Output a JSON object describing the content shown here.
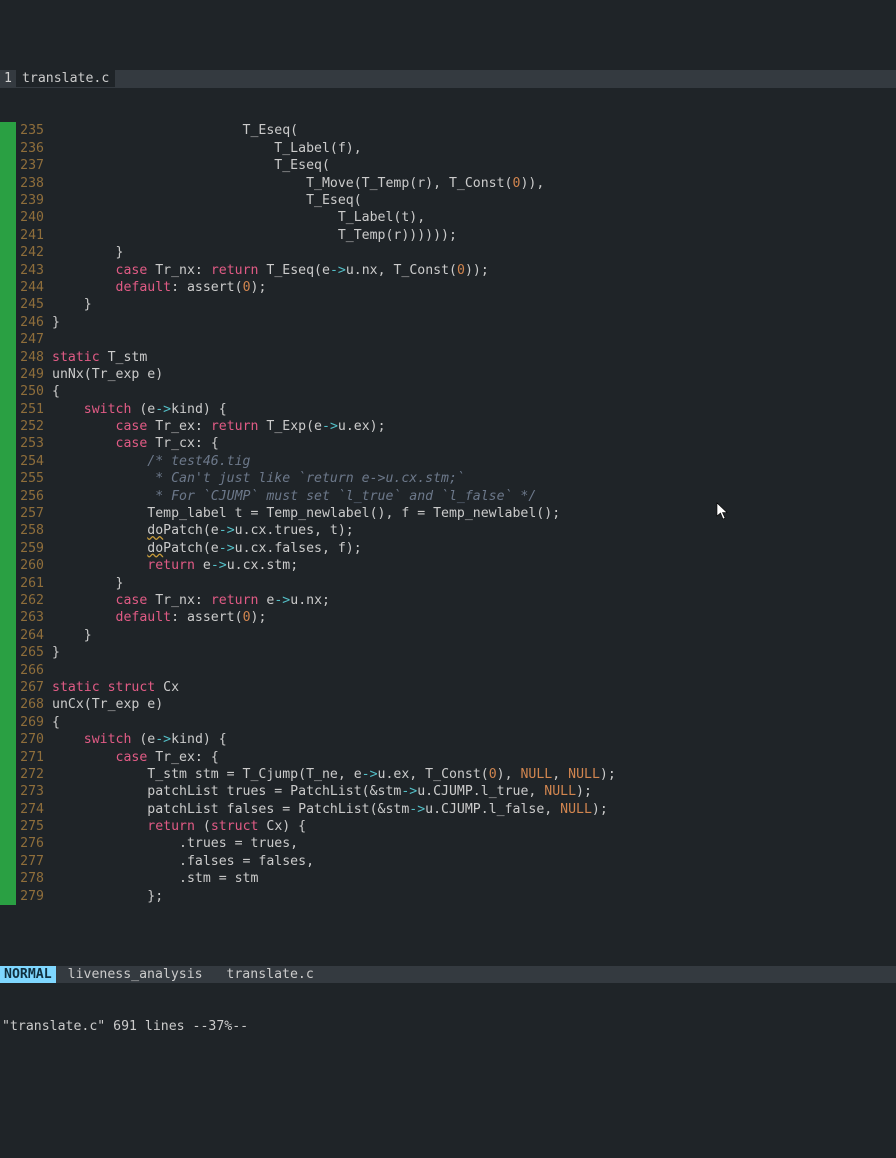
{
  "tabbar": {
    "index": "1",
    "file": "translate.c"
  },
  "statusbar": {
    "mode": "NORMAL",
    "buffers": "liveness_analysis   translate.c"
  },
  "cmdline": "\"translate.c\" 691 lines --37%--",
  "lines": [
    {
      "n": "235",
      "html": "                        T_Eseq("
    },
    {
      "n": "236",
      "html": "                            T_Label(f),"
    },
    {
      "n": "237",
      "html": "                            T_Eseq("
    },
    {
      "n": "238",
      "html": "                                T_Move(T_Temp(r), T_Const(<span class='num'>0</span>)),"
    },
    {
      "n": "239",
      "html": "                                T_Eseq("
    },
    {
      "n": "240",
      "html": "                                    T_Label(t),"
    },
    {
      "n": "241",
      "html": "                                    T_Temp(r))))));"
    },
    {
      "n": "242",
      "html": "        }"
    },
    {
      "n": "243",
      "html": "        <span class='kw'>case</span> Tr_nx: <span class='kw'>return</span> T_Eseq(e<span class='op'>-&gt;</span>u.nx, T_Const(<span class='num'>0</span>));"
    },
    {
      "n": "244",
      "html": "        <span class='kw'>default</span>: assert(<span class='num'>0</span>);"
    },
    {
      "n": "245",
      "html": "    }"
    },
    {
      "n": "246",
      "html": "}"
    },
    {
      "n": "247",
      "html": ""
    },
    {
      "n": "248",
      "html": "<span class='kw'>static</span> T_stm"
    },
    {
      "n": "249",
      "html": "unNx(Tr_exp e)"
    },
    {
      "n": "250",
      "html": "{"
    },
    {
      "n": "251",
      "html": "    <span class='kw'>switch</span> (e<span class='op'>-&gt;</span>kind) {"
    },
    {
      "n": "252",
      "html": "        <span class='kw'>case</span> Tr_ex: <span class='kw'>return</span> T_Exp(e<span class='op'>-&gt;</span>u.ex);"
    },
    {
      "n": "253",
      "html": "        <span class='kw'>case</span> Tr_cx: {"
    },
    {
      "n": "254",
      "html": "            <span class='comment'>/* test46.tig</span>"
    },
    {
      "n": "255",
      "html": "<span class='comment'>             * Can't just like `return e-&gt;u.cx.stm;`</span>"
    },
    {
      "n": "256",
      "html": "<span class='comment'>             * For `CJUMP` must set `l_true` and `l_false` */</span>"
    },
    {
      "n": "257",
      "html": "            Temp_label t = Temp_newlabel(), f = Temp_newlabel();"
    },
    {
      "n": "258",
      "html": "            <span class='underline'>do</span>Patch(e<span class='op'>-&gt;</span>u.cx.trues, t);"
    },
    {
      "n": "259",
      "html": "            <span class='underline'>do</span>Patch(e<span class='op'>-&gt;</span>u.cx.falses, f);"
    },
    {
      "n": "260",
      "html": "            <span class='kw'>return</span> e<span class='op'>-&gt;</span>u.cx.stm;"
    },
    {
      "n": "261",
      "html": "        }"
    },
    {
      "n": "262",
      "html": "        <span class='kw'>case</span> Tr_nx: <span class='kw'>return</span> e<span class='op'>-&gt;</span>u.nx;"
    },
    {
      "n": "263",
      "html": "        <span class='kw'>default</span>: assert(<span class='num'>0</span>);"
    },
    {
      "n": "264",
      "html": "    }"
    },
    {
      "n": "265",
      "html": "}"
    },
    {
      "n": "266",
      "html": ""
    },
    {
      "n": "267",
      "html": "<span class='kw'>static</span> <span class='kw'>struct</span> Cx"
    },
    {
      "n": "268",
      "html": "unCx(Tr_exp e)"
    },
    {
      "n": "269",
      "html": "{"
    },
    {
      "n": "270",
      "html": "    <span class='kw'>switch</span> (e<span class='op'>-&gt;</span>kind) {"
    },
    {
      "n": "271",
      "html": "        <span class='kw'>case</span> Tr_ex: {"
    },
    {
      "n": "272",
      "html": "            T_stm stm = T_Cjump(T_ne, e<span class='op'>-&gt;</span>u.ex, T_Const(<span class='num'>0</span>), <span class='null'>NULL</span>, <span class='null'>NULL</span>);"
    },
    {
      "n": "273",
      "html": "            patchList trues = PatchList(&amp;stm<span class='op'>-&gt;</span>u.CJUMP.l_true, <span class='null'>NULL</span>);"
    },
    {
      "n": "274",
      "html": "            patchList falses = PatchList(&amp;stm<span class='op'>-&gt;</span>u.CJUMP.l_false, <span class='null'>NULL</span>);"
    },
    {
      "n": "275",
      "html": "            <span class='kw'>return</span> (<span class='kw'>struct</span> Cx) {"
    },
    {
      "n": "276",
      "html": "                .trues = trues,"
    },
    {
      "n": "277",
      "html": "                .falses = falses,"
    },
    {
      "n": "278",
      "html": "                .stm = stm"
    },
    {
      "n": "279",
      "html": "            };"
    }
  ]
}
